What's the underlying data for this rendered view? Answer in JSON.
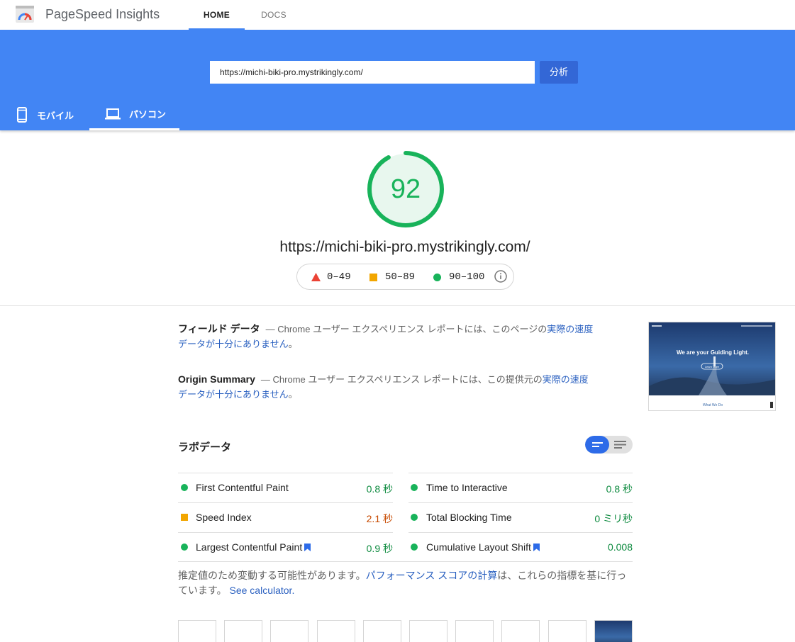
{
  "app": {
    "title": "PageSpeed Insights"
  },
  "nav": {
    "home": "HOME",
    "docs": "DOCS"
  },
  "search": {
    "url": "https://michi-biki-pro.mystrikingly.com/",
    "analyze_label": "分析"
  },
  "device_tabs": {
    "mobile": "モバイル",
    "desktop": "パソコン"
  },
  "score": {
    "value": 92,
    "url": "https://michi-biki-pro.mystrikingly.com/"
  },
  "legend": {
    "fail": "0–49",
    "average": "50–89",
    "pass": "90–100"
  },
  "colors": {
    "pass": "#18b35a",
    "average": "#f2a600",
    "fail": "#eb4335",
    "accent": "#4285f4"
  },
  "field_data": {
    "heading": "フィールド データ",
    "text_before": "— Chrome ユーザー エクスペリエンス レポートには、このページの",
    "link": "実際の速度データが十分にありません",
    "text_after": "。"
  },
  "origin_summary": {
    "heading": "Origin Summary",
    "text_before": "— Chrome ユーザー エクスペリエンス レポートには、この提供元の",
    "link": "実際の速度データが十分にありません",
    "text_after": "。"
  },
  "thumbnail": {
    "headline": "We are your Guiding Light.",
    "button": "Learn More",
    "footer": "What We Do"
  },
  "lab_data": {
    "title": "ラボデータ",
    "metrics_left": [
      {
        "label": "First Contentful Paint",
        "value": "0.8 秒",
        "status": "pass",
        "bookmark": false
      },
      {
        "label": "Speed Index",
        "value": "2.1 秒",
        "status": "average",
        "bookmark": false
      },
      {
        "label": "Largest Contentful Paint",
        "value": "0.9 秒",
        "status": "pass",
        "bookmark": true
      }
    ],
    "metrics_right": [
      {
        "label": "Time to Interactive",
        "value": "0.8 秒",
        "status": "pass",
        "bookmark": false
      },
      {
        "label": "Total Blocking Time",
        "value": "0 ミリ秒",
        "status": "pass",
        "bookmark": false
      },
      {
        "label": "Cumulative Layout Shift",
        "value": "0.008",
        "status": "pass",
        "bookmark": true
      }
    ],
    "note": {
      "before": "推定値のため変動する可能性があります。",
      "link": "パフォーマンス スコアの計算",
      "after": "は、これらの指標を基に行っています。",
      "calculator": "See calculator."
    }
  }
}
